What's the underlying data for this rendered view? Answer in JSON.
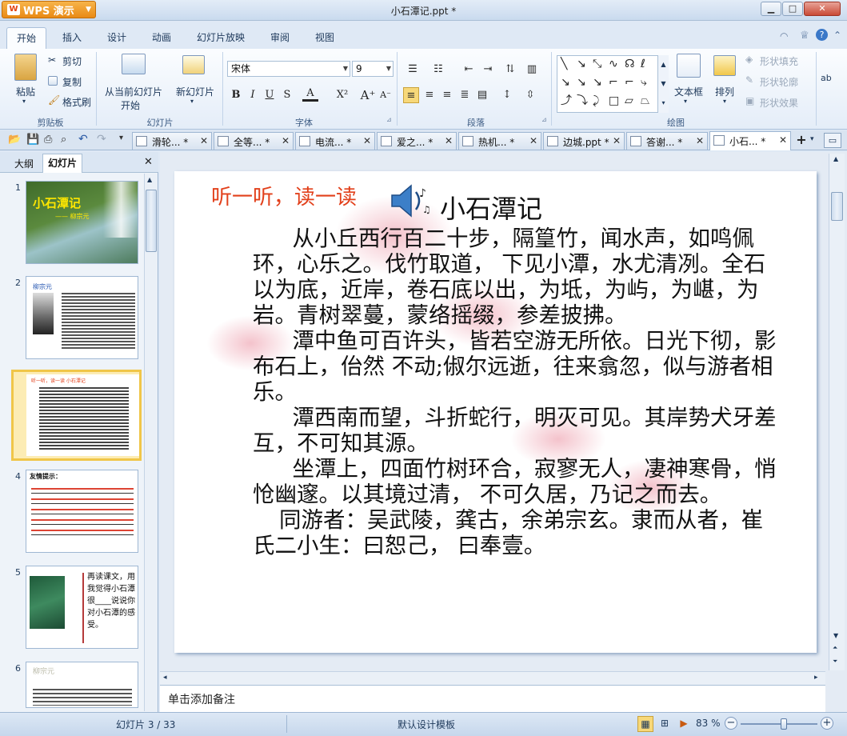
{
  "app": {
    "name": "WPS 演示",
    "window_title": "小石潭记.ppt *"
  },
  "ribbon_tabs": [
    "开始",
    "插入",
    "设计",
    "动画",
    "幻灯片放映",
    "审阅",
    "视图"
  ],
  "ribbon": {
    "clipboard": {
      "paste": "粘贴",
      "cut": "剪切",
      "copy": "复制",
      "format_painter": "格式刷",
      "label": "剪贴板"
    },
    "slides": {
      "from_current": "从当前幻灯片",
      "start": "开始",
      "new_slide": "新幻灯片",
      "label": "幻灯片"
    },
    "font": {
      "family": "宋体",
      "size": "9",
      "label": "字体"
    },
    "paragraph": {
      "label": "段落"
    },
    "drawing": {
      "textbox": "文本框",
      "arrange": "排列",
      "shape_fill": "形状填充",
      "shape_outline": "形状轮廓",
      "shape_effect": "形状效果",
      "label": "绘图"
    }
  },
  "doc_tabs": [
    {
      "label": "滑轮... *"
    },
    {
      "label": "全等... *"
    },
    {
      "label": "电流... *"
    },
    {
      "label": "爱之... *"
    },
    {
      "label": "热机... *"
    },
    {
      "label": "边城.ppt *"
    },
    {
      "label": "答谢... *"
    },
    {
      "label": "小石... *",
      "active": true
    }
  ],
  "left_pane": {
    "tabs": [
      "大纲",
      "幻灯片"
    ],
    "slides": [
      {
        "num": "1",
        "title": "小石潭记",
        "subtitle": "—— 柳宗元"
      },
      {
        "num": "2",
        "caption": "柳宗元"
      },
      {
        "num": "3",
        "caption": "听一听，读一读  小石潭记"
      },
      {
        "num": "4",
        "caption": "友情提示："
      },
      {
        "num": "5",
        "caption": "再读课文，用我觉得小石潭很____说说你对小石潭的感受。"
      },
      {
        "num": "6",
        "caption": "柳宗元"
      }
    ]
  },
  "slide": {
    "listen_title": "听一听，读一读",
    "title": "小石潭记",
    "paragraphs": [
      "从小丘西行百二十步，隔篁竹，闻水声，如鸣佩环，心乐之。伐竹取道， 下见小潭，水尤清冽。全石以为底，近岸，卷石底以出，为坻，为屿，为嵁，为岩。青树翠蔓，蒙络摇缀，参差披拂。",
      "潭中鱼可百许头，皆若空游无所依。日光下彻，影布石上，佁然 不动;俶尔远逝，往来翕忽，似与游者相乐。",
      "潭西南而望，斗折蛇行，明灭可见。其岸势犬牙差互，不可知其源。",
      "坐潭上，四面竹树环合，寂寥无人，凄神寒骨，悄怆幽邃。以其境过清， 不可久居，乃记之而去。",
      "同游者：吴武陵，龚古，余弟宗玄。隶而从者，崔氏二小生：曰恕己， 曰奉壹。"
    ]
  },
  "notes_placeholder": "单击添加备注",
  "status": {
    "slide_count": "幻灯片 3 / 33",
    "template": "默认设计模板",
    "zoom": "83 %",
    "zoom_level": 0.56
  }
}
